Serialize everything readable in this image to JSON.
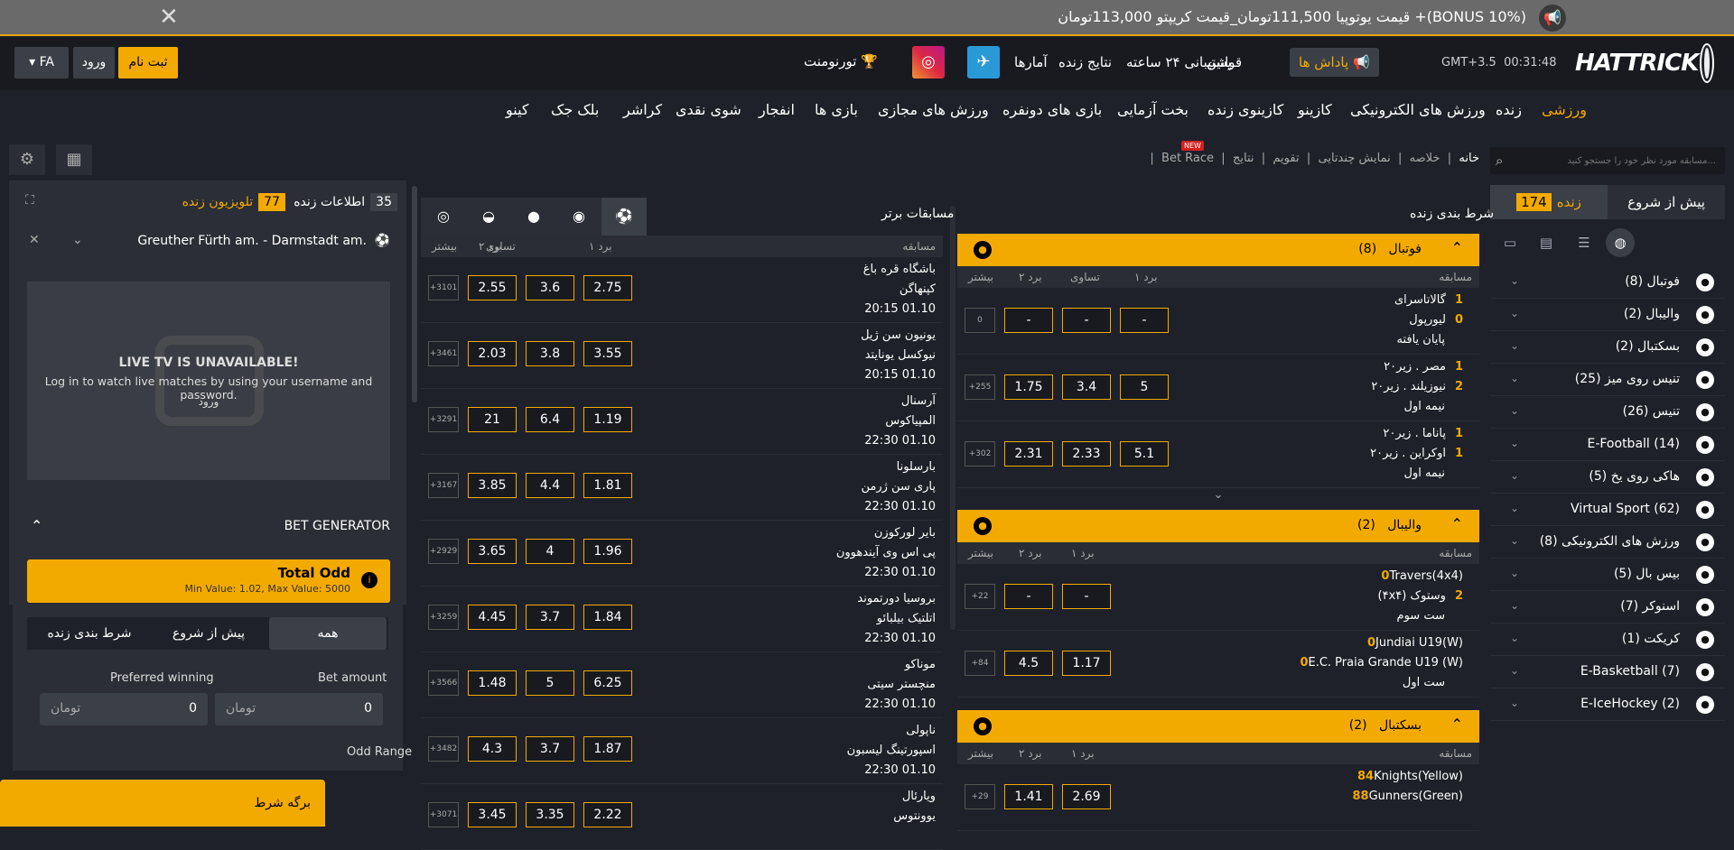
{
  "topbar": {
    "message": "(BONUS 10%)+ قیمت یوتوپیا 111,500تومان_قیمت کریپتو 113,000تومان",
    "close_glyph": "✕"
  },
  "header": {
    "logo_text": "HATTRICK",
    "time": "00:31:48",
    "timezone": "GMT+3.5",
    "reward_label": "پاداش ها",
    "links": [
      "قوانین",
      "پشتیبانی ۲۴ ساعته",
      "نتایج زنده",
      "آمارها"
    ],
    "tournament_label": "تورنومنت",
    "signup_label": "ثبت نام",
    "login_label": "ورود",
    "lang_label": "FA"
  },
  "nav": [
    "ورزشی",
    "زنده",
    "ورزش های الکترونیکی",
    "کازینو",
    "کازینوی زنده",
    "بخت آزمایی",
    "بازی های دونفره",
    "ورزش های مجازی",
    "بازی ها",
    "انفجار",
    "شوی نقدی",
    "کراشر",
    "بلک جک",
    "کینو"
  ],
  "sidebar": {
    "search_placeholder": "مسابقه مورد نظر خود را جستجو کنید...",
    "tab_prematch": "پیش از شروع",
    "tab_live": "زنده",
    "live_count": "174",
    "sports": [
      {
        "label": "فوتبال (8)",
        "icon": "football-icon"
      },
      {
        "label": "والیبال (2)",
        "icon": "volleyball-icon"
      },
      {
        "label": "بسکتبال (2)",
        "icon": "basketball-icon"
      },
      {
        "label": "تنیس روی میز (25)",
        "icon": "table-tennis-icon"
      },
      {
        "label": "تنیس (26)",
        "icon": "tennis-icon"
      },
      {
        "label": "E-Football (14)",
        "icon": "e-football-icon"
      },
      {
        "label": "هاکی روی یخ (5)",
        "icon": "ice-hockey-icon"
      },
      {
        "label": "Virtual Sport (62)",
        "icon": "virtual-sport-icon"
      },
      {
        "label": "ورزش های الکترونیکی (8)",
        "icon": "esports-icon"
      },
      {
        "label": "بیس بال (5)",
        "icon": "baseball-icon"
      },
      {
        "label": "اسنوکر (7)",
        "icon": "snooker-icon"
      },
      {
        "label": "کریکت (1)",
        "icon": "cricket-icon"
      },
      {
        "label": "E-Basketball (7)",
        "icon": "e-basketball-icon"
      },
      {
        "label": "E-IceHockey (2)",
        "icon": "e-icehockey-icon"
      }
    ]
  },
  "breadcrumb": {
    "home": "خانه",
    "items": [
      "خلاصه",
      "نمایش چندتایی",
      "تقویم",
      "نتایج",
      "Bet Race"
    ],
    "new_badge": "NEW"
  },
  "live_section": {
    "title": "شرط بندی زنده",
    "col_match": "مسابقه",
    "col_w1": "برد ۱",
    "col_draw": "تساوی",
    "col_w2": "برد ۲",
    "col_more": "بیشتر",
    "groups": [
      {
        "name": "فوتبال",
        "count": "(8)",
        "matches": [
          {
            "home": "گالاتاسرای",
            "away": "لیورپول",
            "s1": "1",
            "s2": "0",
            "status": "پایان یافته",
            "o1": "-",
            "ox": "-",
            "o2": "-",
            "more": "0"
          },
          {
            "home": "مصر . زیر۲۰",
            "away": "نیوزیلند . زیر۲۰",
            "s1": "1",
            "s2": "2",
            "status": "نیمه اول",
            "o1": "5",
            "ox": "3.4",
            "o2": "1.75",
            "more": "+255"
          },
          {
            "home": "پاناما . زیر۲۰",
            "away": "اوکراین . زیر۲۰",
            "s1": "1",
            "s2": "1",
            "status": "نیمه اول",
            "o1": "5.1",
            "ox": "2.33",
            "o2": "2.31",
            "more": "+302"
          }
        ]
      },
      {
        "name": "والیبال",
        "count": "(2)",
        "matches": [
          {
            "home": "Travers(4x4)",
            "away": "وستوک (۴x۴)",
            "s1": "0",
            "s2": "2",
            "status": "ست سوم",
            "o1": "-",
            "o2": "-",
            "more": "+22"
          },
          {
            "home": "Jundiai U19(W)",
            "away": "E.C. Praia Grande U19 (W)",
            "s1": "0",
            "s2": "0",
            "status": "ست اول",
            "o1": "1.17",
            "o2": "4.5",
            "more": "+84"
          }
        ]
      },
      {
        "name": "بسکتبال",
        "count": "(2)",
        "matches": [
          {
            "home": "Knights(Yellow)",
            "away": "Gunners(Green)",
            "s1": "84",
            "s2": "88",
            "o1": "2.69",
            "o2": "1.41",
            "more": "+29"
          }
        ]
      }
    ]
  },
  "top_section": {
    "title": "مسابقات برتر",
    "col_match": "مسابقه",
    "col_w1": "برد ۱",
    "col_draw": "تساوی",
    "col_w2": "برد ۲",
    "col_more": "بیشتر",
    "matches": [
      {
        "home": "باشگاه قره باغ",
        "away": "کپنهاگن",
        "time": "20:15 01.10",
        "o1": "2.75",
        "ox": "3.6",
        "o2": "2.55",
        "more": "+3101"
      },
      {
        "home": "یونیون سن ژیل",
        "away": "نیوکسل یونایتد",
        "time": "20:15 01.10",
        "o1": "3.55",
        "ox": "3.8",
        "o2": "2.03",
        "more": "+3461"
      },
      {
        "home": "آرسنال",
        "away": "المپیاکوس",
        "time": "22:30 01.10",
        "o1": "1.19",
        "ox": "6.4",
        "o2": "21",
        "more": "+3291"
      },
      {
        "home": "بارسلونا",
        "away": "پاری سن ژرمن",
        "time": "22:30 01.10",
        "o1": "1.81",
        "ox": "4.4",
        "o2": "3.85",
        "more": "+3167"
      },
      {
        "home": "بایر لورکوزن",
        "away": "پی اس وی آیندهوون",
        "time": "22:30 01.10",
        "o1": "1.96",
        "ox": "4",
        "o2": "3.65",
        "more": "+2929"
      },
      {
        "home": "بروسیا دورتموند",
        "away": "اتلتیک بیلبائو",
        "time": "22:30 01.10",
        "o1": "1.84",
        "ox": "3.7",
        "o2": "4.45",
        "more": "+3259"
      },
      {
        "home": "موناکو",
        "away": "منچستر سیتی",
        "time": "22:30 01.10",
        "o1": "6.25",
        "ox": "5",
        "o2": "1.48",
        "more": "+3566"
      },
      {
        "home": "ناپولی",
        "away": "اسپورتینگ لیسبون",
        "time": "22:30 01.10",
        "o1": "1.87",
        "ox": "3.7",
        "o2": "4.3",
        "more": "+3482"
      },
      {
        "home": "ویارئال",
        "away": "یوونتوس",
        "time": "",
        "o1": "2.22",
        "ox": "3.35",
        "o2": "3.45",
        "more": "+3071"
      }
    ]
  },
  "livetv": {
    "info_label": "اطلاعات زنده",
    "info_count": "35",
    "tv_label": "تلویزیون زنده",
    "tv_count": "77",
    "selected_match": "Greuther Fürth am. - Darmstadt am.",
    "unavailable_title": "LIVE TV IS UNAVAILABLE!",
    "unavailable_msg": "Log in to watch live matches by using your username and password.",
    "login_link": "ورود"
  },
  "bet_generator": {
    "title": "BET GENERATOR",
    "total_odd_label": "Total Odd",
    "total_odd_sub": "Min Value: 1.02, Max Value: 5000",
    "seg_all": "همه",
    "seg_pre": "پیش از شروع",
    "seg_live": "شرط بندی زنده",
    "bet_amount_label": "Bet amount",
    "preferred_label": "Preferred winning",
    "bet_amount_value": "0",
    "preferred_value": "0",
    "currency": "تومان",
    "odd_range_label": "Odd Range"
  },
  "betslip_label": "برگه شرط",
  "colors": {
    "accent": "#f3aa00",
    "bg": "#1e2129",
    "panel": "#2b2e36"
  }
}
